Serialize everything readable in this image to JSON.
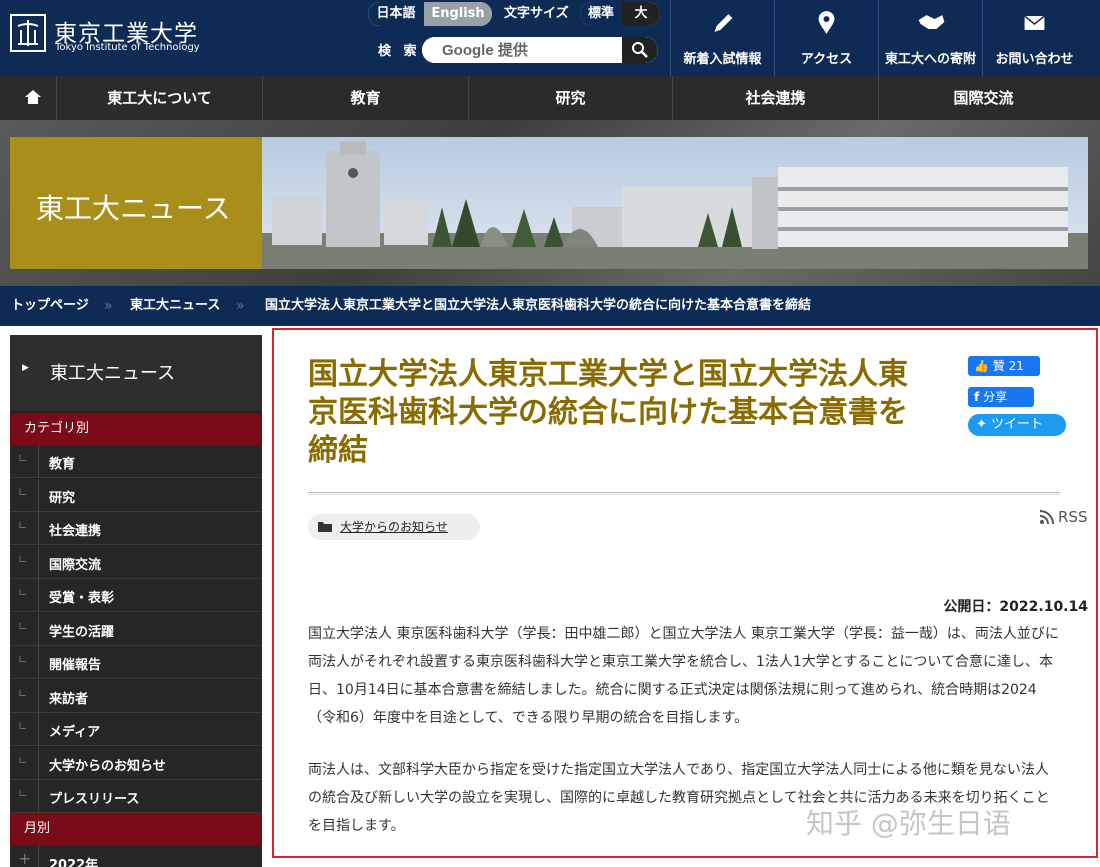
{
  "header": {
    "logo_jp": "東京工業大学",
    "logo_en": "Tokyo Institute of Technology",
    "lang_ja": "日本語",
    "lang_en": "English",
    "font_size_label": "文字サイズ",
    "font_size_standard": "標準",
    "font_size_large": "大",
    "search_label": "検 索",
    "search_placeholder": "Google 提供",
    "util_nav": [
      "新着入試情報",
      "アクセス",
      "東工大への寄附",
      "お問い合わせ"
    ]
  },
  "global_nav": [
    "東工大について",
    "教育",
    "研究",
    "社会連携",
    "国際交流"
  ],
  "banner": {
    "title": "東工大ニュース"
  },
  "breadcrumb": [
    "トップページ",
    "東工大ニュース",
    "国立大学法人東京工業大学と国立大学法人東京医科歯科大学の統合に向けた基本合意書を締結"
  ],
  "sidebar": {
    "heading": "東工大ニュース",
    "section_category": "カテゴリ別",
    "categories": [
      "教育",
      "研究",
      "社会連携",
      "国際交流",
      "受賞・表彰",
      "学生の活躍",
      "開催報告",
      "来訪者",
      "メディア",
      "大学からのお知らせ",
      "プレスリリース"
    ],
    "section_month": "月別",
    "months": [
      "2022年"
    ]
  },
  "article": {
    "title": "国立大学法人東京工業大学と国立大学法人東京医科歯科大学の統合に向けた基本合意書を締結",
    "like_label": "贊 21",
    "share_label": "分享",
    "tweet_label": "ツイート",
    "category": "大学からのお知らせ",
    "rss": "RSS",
    "published": "公開日：2022.10.14",
    "paragraphs": [
      "国立大学法人 東京医科歯科大学（学長：田中雄二郎）と国立大学法人 東京工業大学（学長：益一哉）は、両法人並びに両法人がそれぞれ設置する東京医科歯科大学と東京工業大学を統合し、1法人1大学とすることについて合意に達し、本日、10月14日に基本合意書を締結しました。統合に関する正式決定は関係法規に則って進められ、統合時期は2024（令和6）年度中を目途として、できる限り早期の統合を目指します。",
      "両法人は、文部科学大臣から指定を受けた指定国立大学法人であり、指定国立大学法人同士による他に類を見ない法人の統合及び新しい大学の設立を実現し、国際的に卓越した教育研究拠点として社会と共に活力ある未来を切り拓くことを目指します。"
    ]
  },
  "watermark": "知乎 @弥生日语",
  "colors": {
    "navy": "#0d2b55",
    "gold": "#a98f1a",
    "title_gold": "#8a6b00",
    "maroon": "#7a0c1a",
    "highlight_red": "#d9262c"
  }
}
